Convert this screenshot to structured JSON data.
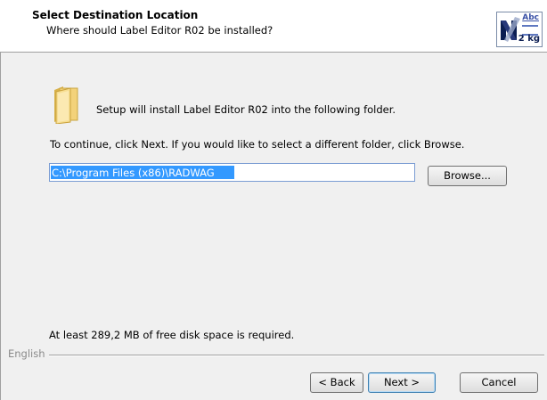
{
  "header": {
    "title": "Select Destination Location",
    "subtitle": "Where should Label Editor R02 be installed?",
    "logo": {
      "abc_text": "Abc",
      "weight_text": "2 kg",
      "icon": "label-editor-logo-icon"
    }
  },
  "main": {
    "folder_icon": "folder-icon",
    "intro_text": "Setup will install Label Editor R02 into the following folder.",
    "instructions_text": "To continue, click Next. If you would like to select a different folder, click Browse.",
    "path_value": "C:\\Program Files (x86)\\RADWAG",
    "browse_label": "Browse...",
    "disk_space_text": "At least 289,2 MB of free disk space is required."
  },
  "footer": {
    "language_label": "English",
    "back_label": "< Back",
    "next_label": "Next >",
    "cancel_label": "Cancel"
  },
  "colors": {
    "selection": "#3399ff",
    "header_bg": "#ffffff",
    "body_bg": "#f0f0f0",
    "logo_blue": "#3950a6"
  }
}
